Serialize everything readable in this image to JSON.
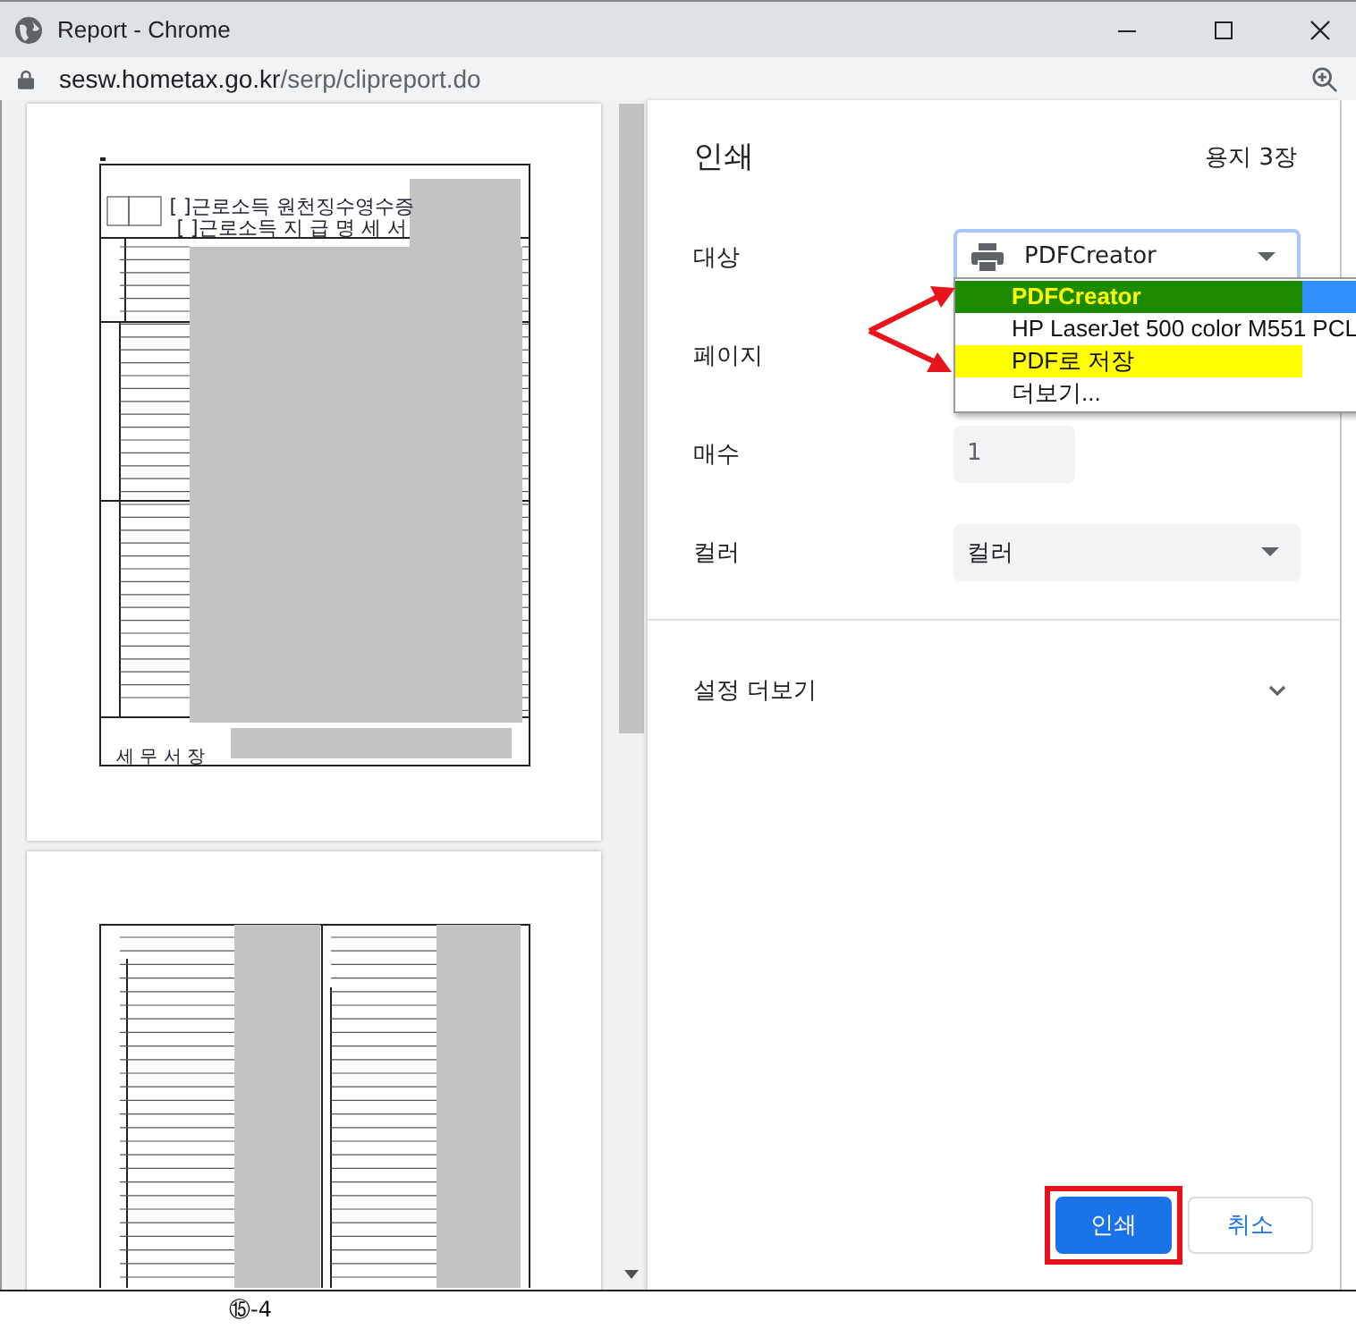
{
  "window": {
    "title": "Report - Chrome"
  },
  "address_bar": {
    "domain": "sesw.hometax.go.kr",
    "path": "/serp/clipreport.do"
  },
  "preview": {
    "first_page": {
      "heading_lines": [
        "[ ]근로소득 원천징수영수증",
        "[ ]근로소득 지 급 명 세 서"
      ],
      "footer": "세 무 서 장"
    }
  },
  "print_panel": {
    "title": "인쇄",
    "sheet_count": "용지 3장",
    "settings": [
      {
        "kind": "select",
        "label": "대상",
        "value": "PDFCreator",
        "printer_icon": true
      },
      {
        "kind": "blank",
        "label": "페이지"
      },
      {
        "kind": "input",
        "label": "매수",
        "value": "1"
      },
      {
        "kind": "select",
        "label": "컬러",
        "value": "컬러",
        "printer_icon": false
      }
    ],
    "more_settings": "설정 더보기",
    "buttons": [
      {
        "label": "인쇄",
        "primary": true,
        "outlined": true
      },
      {
        "label": "취소",
        "primary": false,
        "outlined": false
      }
    ]
  },
  "destination_menu": {
    "items": [
      {
        "label": "PDFCreator",
        "selected": true,
        "color": "#1e8a00"
      },
      {
        "label": "HP LaserJet 500 color M551 PCL",
        "selected": false
      },
      {
        "label": "PDF로 저장",
        "selected": false,
        "color": "#ffff00"
      },
      {
        "label": "더보기...",
        "selected": false
      }
    ]
  },
  "background_page": {
    "cell": "⑮-4"
  }
}
